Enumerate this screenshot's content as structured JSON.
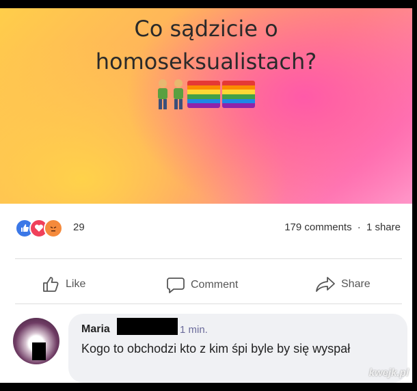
{
  "post": {
    "text_line1": "Co sądzicie o",
    "text_line2": "homoseksualistach?",
    "emojis": [
      "two-men-icon",
      "rainbow-flag-icon",
      "rainbow-flag-icon"
    ]
  },
  "reactions": {
    "icons": [
      "like-reaction-icon",
      "love-reaction-icon",
      "angry-reaction-icon"
    ],
    "count": "29",
    "comments": "179 comments",
    "separator": "·",
    "shares": "1 share"
  },
  "actions": {
    "like": "Like",
    "comment": "Comment",
    "share": "Share"
  },
  "comment": {
    "author": "Maria",
    "time": "1 min.",
    "text": "Kogo to obchodzi kto z kim śpi byle by się wyspał"
  },
  "watermark": "kwejk.pl",
  "colors": {
    "like_blue": "#3b78e7",
    "love_red": "#f0405a",
    "angry_orange": "#f58a3c",
    "time_text": "#6a6a9a"
  }
}
